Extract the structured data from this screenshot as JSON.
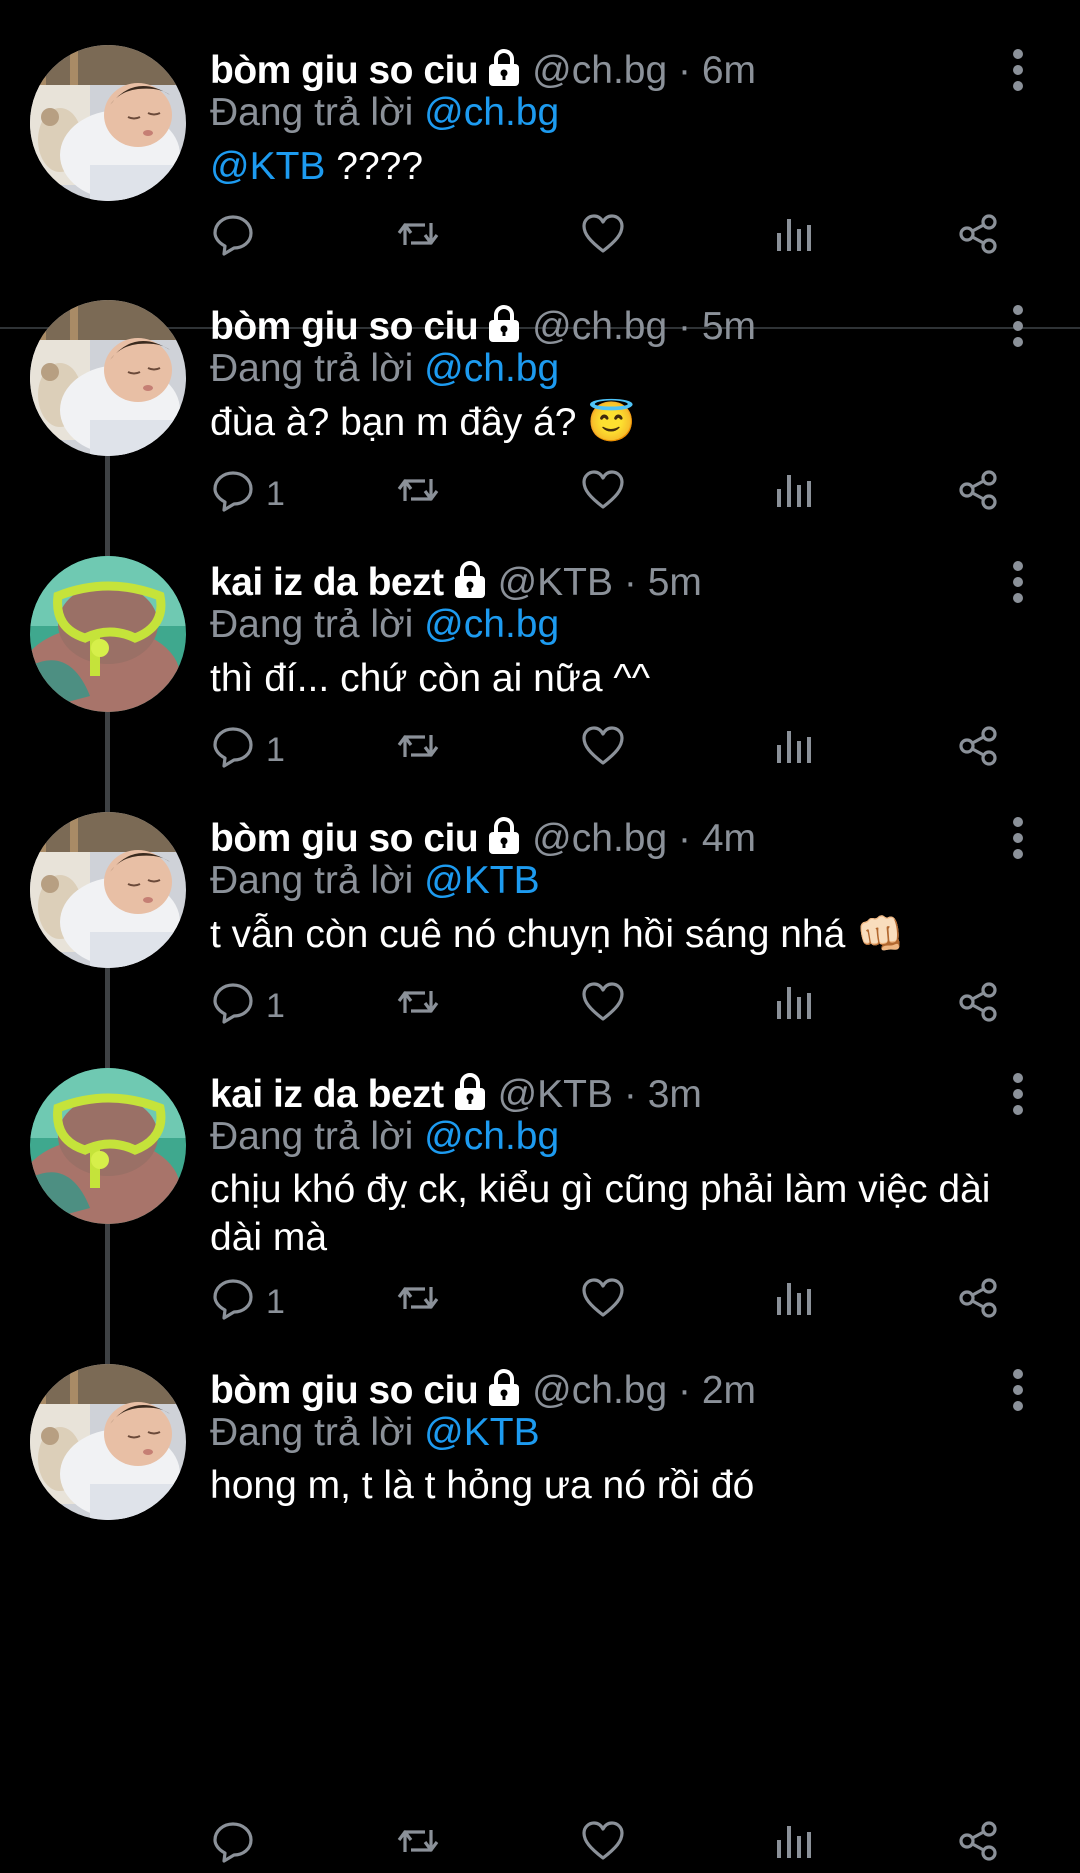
{
  "tweets": [
    {
      "name": "bòm giu so ciu",
      "handle": "@ch.bg",
      "dot": "·",
      "time": "6m",
      "reply_prefix": "Đang trả lời",
      "reply_to": "@ch.bg",
      "text_mention": "@KTB",
      "text": " ????",
      "reply_count": "",
      "avatar": "sleeping-baby"
    },
    {
      "name": "bòm giu so ciu",
      "handle": "@ch.bg",
      "dot": "·",
      "time": "5m",
      "reply_prefix": "Đang trả lời",
      "reply_to": "@ch.bg",
      "text": "đùa à? bạn m đây á? 😇",
      "reply_count": "1",
      "avatar": "sleeping-baby"
    },
    {
      "name": "kai iz da bezt",
      "handle": "@KTB",
      "dot": "·",
      "time": "5m",
      "reply_prefix": "Đang trả lời",
      "reply_to": "@ch.bg",
      "text": "thì đí... chứ còn ai nữa ^^",
      "reply_count": "1",
      "avatar": "snorkel-mask"
    },
    {
      "name": "bòm giu so ciu",
      "handle": "@ch.bg",
      "dot": "·",
      "time": "4m",
      "reply_prefix": "Đang trả lời",
      "reply_to": "@KTB",
      "text": "t vẫn còn cuê nó chuyṇ hồi sáng nhá 👊🏻",
      "reply_count": "1",
      "avatar": "sleeping-baby"
    },
    {
      "name": "kai iz da bezt",
      "handle": "@KTB",
      "dot": "·",
      "time": "3m",
      "reply_prefix": "Đang trả lời",
      "reply_to": "@ch.bg",
      "text": "chịu khó đỵ ck, kiểu gì cũng phải làm việc dài dài mà",
      "reply_count": "1",
      "avatar": "snorkel-mask"
    },
    {
      "name": "bòm giu so ciu",
      "handle": "@ch.bg",
      "dot": "·",
      "time": "2m",
      "reply_prefix": "Đang trả lời",
      "reply_to": "@KTB",
      "text": "hong m, t là t hỏng ưa nó rồi đó",
      "reply_count": "",
      "avatar": "sleeping-baby"
    }
  ],
  "icons": {
    "lock": "lock-icon",
    "more": "more-vertical-icon",
    "reply": "reply-icon",
    "retweet": "retweet-icon",
    "like": "heart-icon",
    "views": "analytics-icon",
    "share": "share-icon"
  },
  "colors": {
    "background": "#000000",
    "name": "#ffffff",
    "secondary": "#8b9199",
    "mention": "#1d9bf0",
    "thread_line": "#3e4144"
  }
}
